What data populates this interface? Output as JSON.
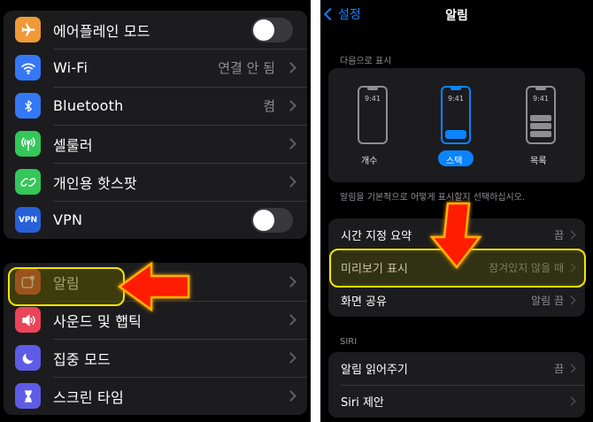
{
  "settings": {
    "items": [
      {
        "label": "에어플레인 모드",
        "value": "",
        "icon": "airplane-icon",
        "color": "#f09a37",
        "type": "toggle"
      },
      {
        "label": "Wi-Fi",
        "value": "연결 안 됨",
        "icon": "wifi-icon",
        "color": "#3478f6",
        "type": "link"
      },
      {
        "label": "Bluetooth",
        "value": "켬",
        "icon": "bluetooth-icon",
        "color": "#3478f6",
        "type": "link"
      },
      {
        "label": "셀룰러",
        "value": "",
        "icon": "cellular-icon",
        "color": "#34c759",
        "type": "link"
      },
      {
        "label": "개인용 핫스팟",
        "value": "",
        "icon": "hotspot-icon",
        "color": "#34c759",
        "type": "link"
      },
      {
        "label": "VPN",
        "value": "",
        "icon": "vpn-icon",
        "color": "#2860d9",
        "type": "toggle",
        "icon_text": "VPN"
      }
    ],
    "items2": [
      {
        "label": "알림",
        "icon": "notification-bell-icon",
        "color": "#eb4e3d"
      },
      {
        "label": "사운드 및 햅틱",
        "icon": "speaker-icon",
        "color": "#eb445a"
      },
      {
        "label": "집중 모드",
        "icon": "moon-icon",
        "color": "#5e5ce6"
      },
      {
        "label": "스크린 타임",
        "icon": "hourglass-icon",
        "color": "#5e5ce6"
      }
    ]
  },
  "notifications": {
    "back_label": "설정",
    "title": "알림",
    "display_as_header": "다음으로 표시",
    "display_options": [
      {
        "label": "개수",
        "time": "9:41"
      },
      {
        "label": "스택",
        "time": "9:41"
      },
      {
        "label": "목록",
        "time": "9:41"
      }
    ],
    "selected_option": "스택",
    "description": "알림을 기본적으로 어떻게 표시할지 선택하십시오.",
    "rows": [
      {
        "label": "시간 지정 요약",
        "value": "끔"
      },
      {
        "label": "미리보기 표시",
        "value": "잠겨있지 않을 때"
      },
      {
        "label": "화면 공유",
        "value": "알림 끔"
      }
    ],
    "siri_header": "SIRI",
    "siri_rows": [
      {
        "label": "알림 읽어주기",
        "value": "끔"
      },
      {
        "label": "Siri 제안",
        "value": ""
      }
    ]
  },
  "colors": {
    "highlight": "#f5e400",
    "arrow": "#ff1a00",
    "accent": "#0a84ff"
  }
}
